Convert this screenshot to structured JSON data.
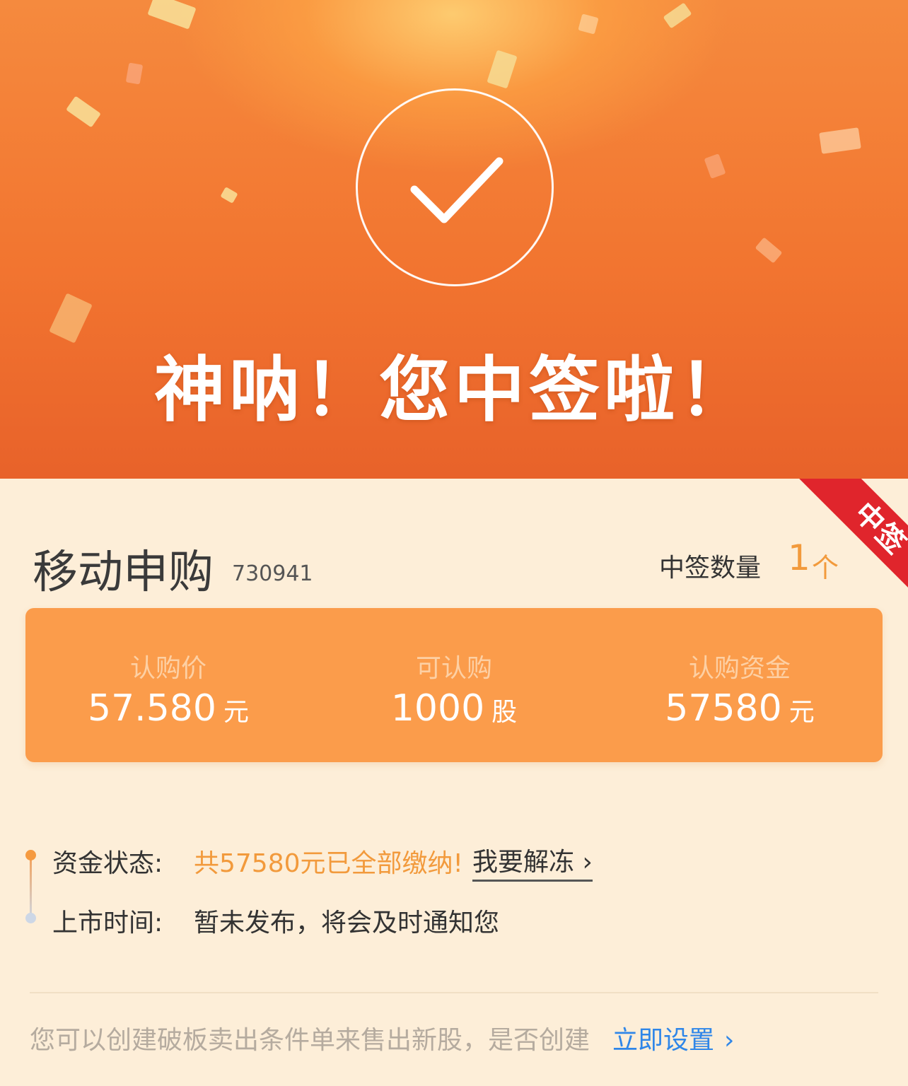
{
  "hero": {
    "title": "神呐！您中签啦！",
    "icon": "checkmark-icon"
  },
  "ribbon": {
    "text": "中签",
    "color": "#e0252c"
  },
  "stock": {
    "name": "移动申购",
    "code": "730941",
    "count_label": "中签数量",
    "count_value": "1",
    "count_unit": "个"
  },
  "card": {
    "color": "#fb9c4b",
    "items": [
      {
        "label": "认购价",
        "value": "57.580",
        "unit": "元"
      },
      {
        "label": "可认购",
        "value": "1000",
        "unit": "股"
      },
      {
        "label": "认购资金",
        "value": "57580",
        "unit": "元"
      }
    ]
  },
  "info": {
    "fund_status_label": "资金状态:",
    "fund_status_value": "共57580元已全部缴纳!",
    "unfreeze_label": "我要解冻 ›",
    "listing_label": "上市时间:",
    "listing_value": "暂未发布，将会及时通知您"
  },
  "footer": {
    "text": "您可以创建破板卖出条件单来售出新股，是否创建",
    "link": "立即设置",
    "link_chevron": "›",
    "link_color": "#2f86e8"
  }
}
